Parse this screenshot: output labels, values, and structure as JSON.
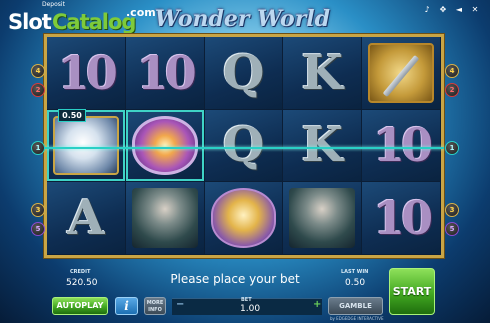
{
  "header": {
    "logo": {
      "slot": "Slot",
      "catalog": "Catalog",
      "com": ".com"
    },
    "deposit": "Deposit",
    "title": "Wonder World",
    "icons": [
      "music-icon",
      "settings-icon",
      "sound-icon",
      "close-icon"
    ]
  },
  "reels": [
    [
      {
        "symbol": "10",
        "kind": "big"
      },
      {
        "symbol": "10",
        "kind": "big"
      },
      {
        "symbol": "Q",
        "kind": "letter"
      },
      {
        "symbol": "K",
        "kind": "letter"
      },
      {
        "symbol": "",
        "kind": "sword"
      }
    ],
    [
      {
        "symbol": "",
        "kind": "unicorn"
      },
      {
        "symbol": "",
        "kind": "portal"
      },
      {
        "symbol": "Q",
        "kind": "letter"
      },
      {
        "symbol": "K",
        "kind": "letter"
      },
      {
        "symbol": "10",
        "kind": "big"
      }
    ],
    [
      {
        "symbol": "A",
        "kind": "letter"
      },
      {
        "symbol": "",
        "kind": "wizard"
      },
      {
        "symbol": "",
        "kind": "castle"
      },
      {
        "symbol": "",
        "kind": "wizard"
      },
      {
        "symbol": "10",
        "kind": "big"
      }
    ]
  ],
  "win": {
    "badge": "0.50"
  },
  "line_markers": {
    "left": [
      "4",
      "2",
      "1",
      "3",
      "5"
    ],
    "right": [
      "4",
      "2",
      "1",
      "3",
      "5"
    ]
  },
  "panel": {
    "credit_label": "CREDIT",
    "credit_value": "520.50",
    "message": "Please place your bet",
    "last_win_label": "LAST WIN",
    "last_win_value": "0.50",
    "autoplay_label": "AUTOPLAY",
    "info_label": "i",
    "more_info_label": "MORE INFO",
    "bet_label": "BET",
    "bet_value": "1.00",
    "bet_minus": "−",
    "bet_plus": "+",
    "gamble_label": "GAMBLE",
    "start_label": "START",
    "footer": "by EDGEDGE INTERACTIVE"
  }
}
